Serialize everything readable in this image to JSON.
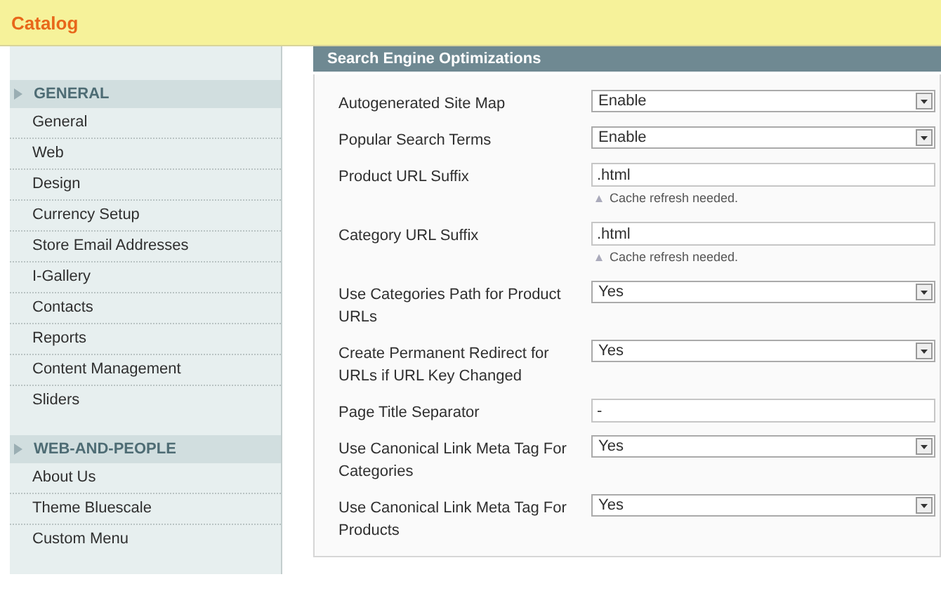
{
  "banner": {
    "title": "Catalog"
  },
  "sidebar": {
    "sections": [
      {
        "title": "GENERAL",
        "items": [
          {
            "label": "General"
          },
          {
            "label": "Web"
          },
          {
            "label": "Design"
          },
          {
            "label": "Currency Setup"
          },
          {
            "label": "Store Email Addresses"
          },
          {
            "label": "I-Gallery"
          },
          {
            "label": "Contacts"
          },
          {
            "label": "Reports"
          },
          {
            "label": "Content Management"
          },
          {
            "label": "Sliders"
          }
        ]
      },
      {
        "title": "WEB-AND-PEOPLE",
        "items": [
          {
            "label": "About Us"
          },
          {
            "label": "Theme Bluescale"
          },
          {
            "label": "Custom Menu"
          }
        ]
      }
    ]
  },
  "main": {
    "open_group": {
      "title": "Search Engine Optimizations",
      "fields": [
        {
          "kind": "select",
          "label": "Autogenerated Site Map",
          "value": "Enable"
        },
        {
          "kind": "select",
          "label": "Popular Search Terms",
          "value": "Enable"
        },
        {
          "kind": "text",
          "label": "Product URL Suffix",
          "value": ".html",
          "note": "Cache refresh needed."
        },
        {
          "kind": "text",
          "label": "Category URL Suffix",
          "value": ".html",
          "note": "Cache refresh needed."
        },
        {
          "kind": "select",
          "label": "Use Categories Path for Product URLs",
          "value": "Yes"
        },
        {
          "kind": "select",
          "label": "Create Permanent Redirect for URLs if URL Key Changed",
          "value": "Yes"
        },
        {
          "kind": "text",
          "label": "Page Title Separator",
          "value": "-"
        },
        {
          "kind": "select",
          "label": "Use Canonical Link Meta Tag For Categories",
          "value": "Yes"
        },
        {
          "kind": "select",
          "label": "Use Canonical Link Meta Tag For Products",
          "value": "Yes"
        }
      ]
    }
  }
}
